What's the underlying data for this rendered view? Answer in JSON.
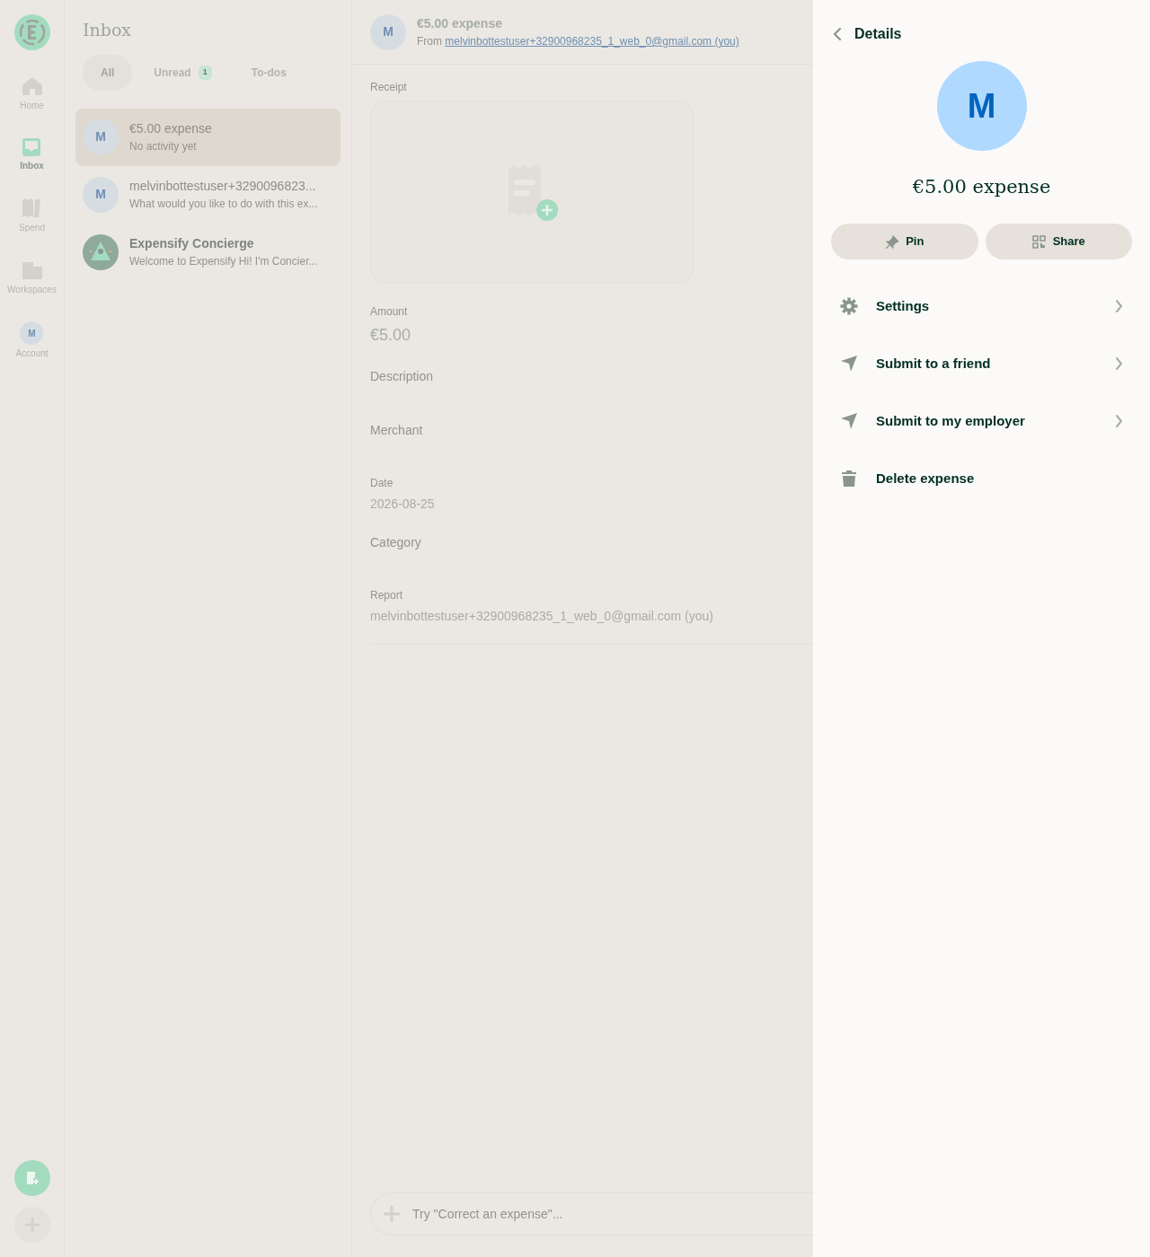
{
  "nav_rail": {
    "items": [
      {
        "label": "Home",
        "kind": "home",
        "selected": false
      },
      {
        "label": "Inbox",
        "kind": "inbox",
        "selected": true
      },
      {
        "label": "Spend",
        "kind": "spend",
        "selected": false
      },
      {
        "label": "Workspaces",
        "kind": "workspaces",
        "selected": false
      },
      {
        "label": "Account",
        "kind": "account",
        "avatar_letter": "M",
        "selected": false
      }
    ]
  },
  "inbox": {
    "title": "Inbox",
    "tabs": [
      {
        "label": "All",
        "selected": true
      },
      {
        "label": "Unread",
        "badge": "1",
        "selected": false
      },
      {
        "label": "To-dos",
        "selected": false
      }
    ],
    "chats": [
      {
        "kind": "user",
        "avatar_letter": "M",
        "title": "€5.00 expense",
        "subtitle": "No activity yet",
        "bold": false,
        "selected": true
      },
      {
        "kind": "user",
        "avatar_letter": "M",
        "title": "melvinbottestuser+3290096823...",
        "subtitle": "What would you like to do with this ex...",
        "bold": false,
        "selected": false
      },
      {
        "kind": "concierge",
        "title": "Expensify Concierge",
        "subtitle": "Welcome to Expensify Hi! I'm Concier...",
        "bold": true,
        "selected": false
      }
    ]
  },
  "report": {
    "avatar_letter": "M",
    "title": "€5.00 expense",
    "from_label": "From",
    "from_link": "melvinbottestuser+32900968235_1_web_0@gmail.com (you)",
    "receipt_label": "Receipt",
    "fields": [
      {
        "label": "Amount",
        "value": "€5.00"
      },
      {
        "label": "Description"
      },
      {
        "label": "Merchant"
      },
      {
        "label": "Date",
        "value": "2026-08-25"
      },
      {
        "label": "Category"
      },
      {
        "label": "Report",
        "value": "melvinbottestuser+32900968235_1_web_0@gmail.com (you)"
      }
    ],
    "composer": {
      "placeholder": "Try \"Correct an expense\"..."
    }
  },
  "details": {
    "title": "Details",
    "avatar_letter": "M",
    "heading": "€5.00 expense",
    "buttons": [
      {
        "label": "Pin",
        "kind": "pin"
      },
      {
        "label": "Share",
        "kind": "share"
      }
    ],
    "menu": [
      {
        "label": "Settings",
        "kind": "settings",
        "arrow": true
      },
      {
        "label": "Submit to a friend",
        "kind": "send",
        "arrow": true
      },
      {
        "label": "Submit to my employer",
        "kind": "send",
        "arrow": true
      },
      {
        "label": "Delete expense",
        "kind": "trash",
        "arrow": false
      }
    ]
  }
}
